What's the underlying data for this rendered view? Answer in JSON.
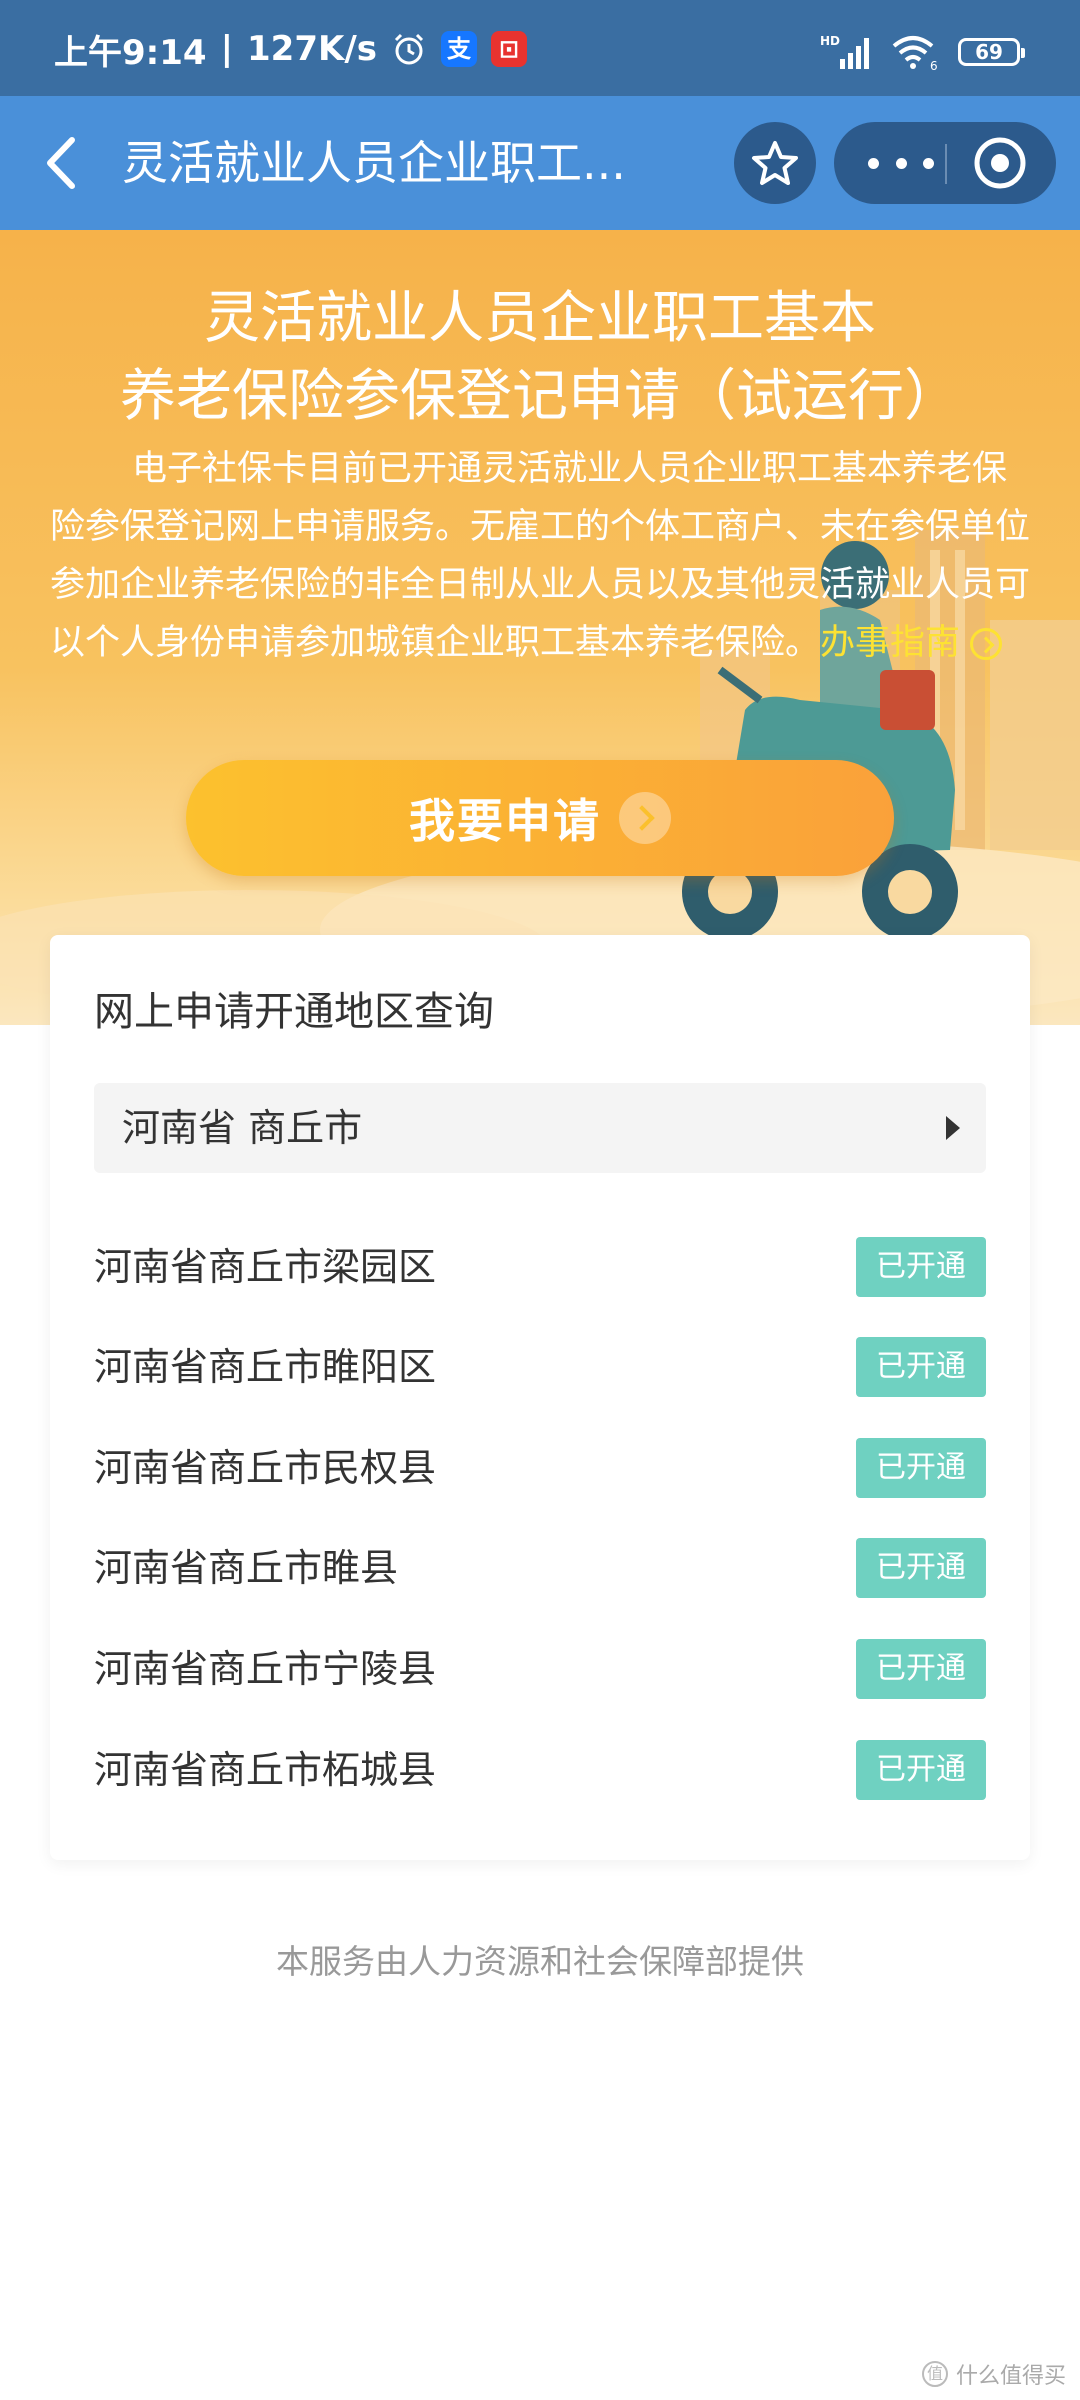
{
  "status_bar": {
    "time": "上午9:14",
    "speed": "127K/s",
    "signal_label": "HD",
    "wifi_label": "6",
    "battery": "69"
  },
  "nav": {
    "title": "灵活就业人员企业职工..."
  },
  "banner": {
    "title_line1": "灵活就业人员企业职工基本",
    "title_line2": "养老保险参保登记申请（试运行）",
    "description": "电子社保卡目前已开通灵活就业人员企业职工基本养老保险参保登记网上申请服务。无雇工的个体工商户、未在参保单位参加企业养老保险的非全日制从业人员以及其他灵活就业人员可以个人身份申请参加城镇企业职工基本养老保险。",
    "guide_link": "办事指南",
    "apply_button": "我要申请"
  },
  "query": {
    "title": "网上申请开通地区查询",
    "selected_region": "河南省 商丘市",
    "regions": [
      {
        "name": "河南省商丘市梁园区",
        "status": "已开通"
      },
      {
        "name": "河南省商丘市睢阳区",
        "status": "已开通"
      },
      {
        "name": "河南省商丘市民权县",
        "status": "已开通"
      },
      {
        "name": "河南省商丘市睢县",
        "status": "已开通"
      },
      {
        "name": "河南省商丘市宁陵县",
        "status": "已开通"
      },
      {
        "name": "河南省商丘市柘城县",
        "status": "已开通"
      }
    ]
  },
  "footer": {
    "text": "本服务由人力资源和社会保障部提供"
  },
  "watermark": {
    "text": "什么值得买",
    "icon_glyph": "值"
  },
  "colors": {
    "status_bar": "#3a6ea2",
    "nav_bar": "#4a90d9",
    "banner": "#f6b24a",
    "badge": "#6fd1c1",
    "link": "#fde233"
  }
}
